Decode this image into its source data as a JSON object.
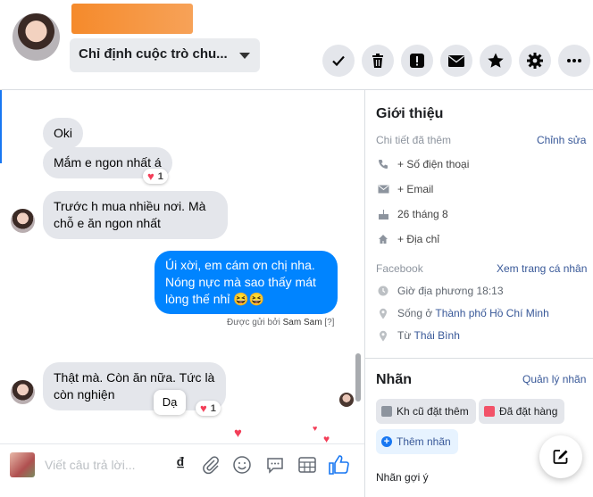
{
  "header": {
    "assign_label": "Chỉ định cuộc trò chu...",
    "actions": [
      {
        "name": "done",
        "icon": "check-icon"
      },
      {
        "name": "delete",
        "icon": "trash-icon"
      },
      {
        "name": "spam",
        "icon": "alert-icon"
      },
      {
        "name": "unread",
        "icon": "envelope-icon"
      },
      {
        "name": "star",
        "icon": "star-icon"
      },
      {
        "name": "settings",
        "icon": "gear-icon"
      },
      {
        "name": "more",
        "icon": "more-icon"
      }
    ]
  },
  "messages": [
    {
      "text": "Oki",
      "from": "contact"
    },
    {
      "text": "Mắm e ngon nhất á",
      "from": "contact",
      "reaction_count": "1"
    },
    {
      "text": "Trước h mua nhiều nơi. Mà chỗ e ăn ngon nhất",
      "from": "contact"
    },
    {
      "text": "Úi xời, em cám ơn chị nha. Nóng nực mà sao thấy mát lòng thế nhỉ 😆😆",
      "from": "page"
    },
    {
      "text": "Thật mà. Còn ăn nữa. Tức là còn nghiện",
      "from": "contact",
      "reaction_count": "1"
    }
  ],
  "sent_by": {
    "prefix": "Được gửi bởi",
    "name": "Sam Sam",
    "suffix": "[?]"
  },
  "tooltip": "Dạ",
  "composer": {
    "placeholder": "Viết câu trả lời...",
    "currency_glyph": "₫"
  },
  "about": {
    "title": "Giới thiệu",
    "details_label": "Chi tiết đã thêm",
    "edit_link": "Chỉnh sửa",
    "phone": "+ Số điện thoại",
    "email": "+ Email",
    "birthday": "26 tháng 8",
    "address": "+ Địa chỉ",
    "facebook_label": "Facebook",
    "profile_link": "Xem trang cá nhân",
    "local_time": "Giờ địa phương 18:13",
    "lives_in_prefix": "Sống ở",
    "lives_in_city": "Thành phố Hồ Chí Minh",
    "from_prefix": "Từ",
    "from_city": "Thái Bình"
  },
  "labels": {
    "title": "Nhãn",
    "manage_link": "Quản lý nhãn",
    "tags": [
      {
        "text": "Kh cũ đặt thêm",
        "color": "#8d949e"
      },
      {
        "text": "Đã đặt hàng",
        "color": "#f25268"
      }
    ],
    "add_tag": "Thêm nhãn",
    "suggested": "Nhãn gợi ý"
  },
  "colors": {
    "accent": "#0084ff",
    "link": "#385898",
    "heart": "#f33e58"
  }
}
